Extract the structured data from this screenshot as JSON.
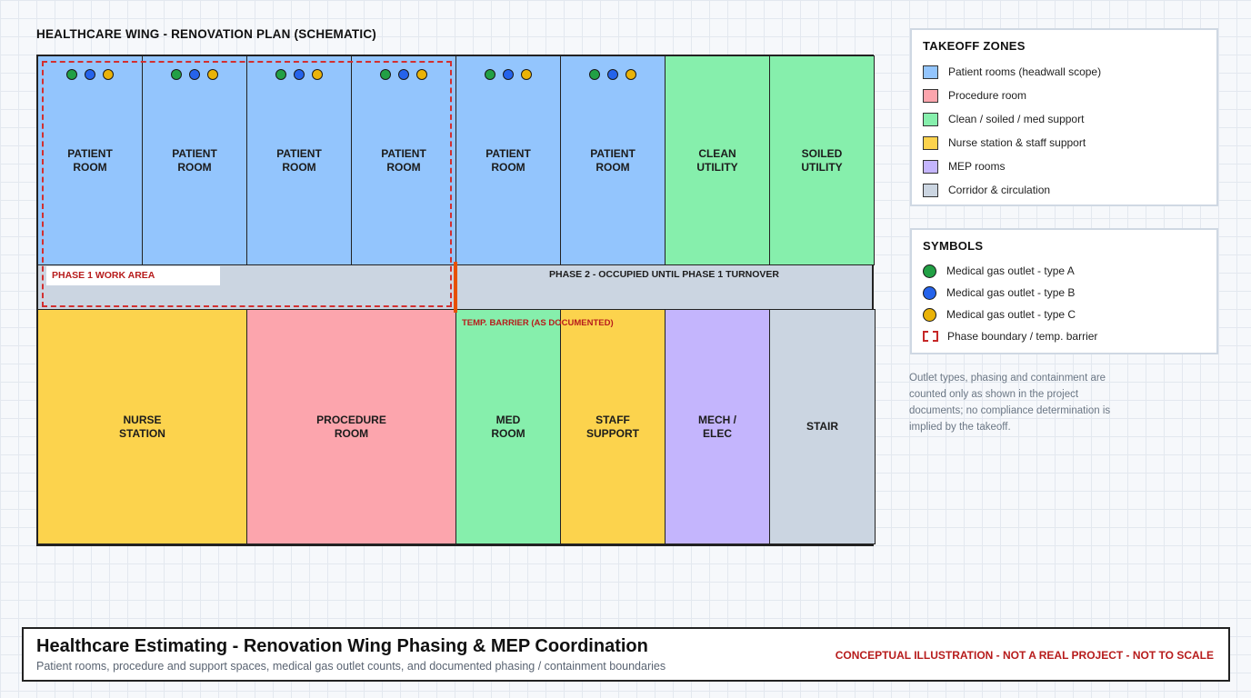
{
  "plan": {
    "title": "HEALTHCARE WING - RENOVATION PLAN (SCHEMATIC)",
    "rooms_top": [
      {
        "label": "PATIENT\nROOM",
        "zone": "patient",
        "outlets": [
          "A",
          "B",
          "C"
        ]
      },
      {
        "label": "PATIENT\nROOM",
        "zone": "patient",
        "outlets": [
          "A",
          "B",
          "C"
        ]
      },
      {
        "label": "PATIENT\nROOM",
        "zone": "patient",
        "outlets": [
          "A",
          "B",
          "C"
        ]
      },
      {
        "label": "PATIENT\nROOM",
        "zone": "patient",
        "outlets": [
          "A",
          "B",
          "C"
        ]
      },
      {
        "label": "PATIENT\nROOM",
        "zone": "patient",
        "outlets": [
          "A",
          "B",
          "C"
        ]
      },
      {
        "label": "PATIENT\nROOM",
        "zone": "patient",
        "outlets": [
          "A",
          "B",
          "C"
        ]
      },
      {
        "label": "CLEAN\nUTILITY",
        "zone": "support"
      },
      {
        "label": "SOILED\nUTILITY",
        "zone": "support"
      }
    ],
    "rooms_bottom": [
      {
        "label": "NURSE\nSTATION",
        "zone": "nurse"
      },
      {
        "label": "PROCEDURE\nROOM",
        "zone": "procedure"
      },
      {
        "label": "MED\nROOM",
        "zone": "support"
      },
      {
        "label": "STAFF\nSUPPORT",
        "zone": "nurse"
      },
      {
        "label": "MECH /\nELEC",
        "zone": "mep"
      },
      {
        "label": "STAIR",
        "zone": "corridor"
      }
    ],
    "phase1_label": "PHASE 1 WORK AREA",
    "phase2_label": "PHASE 2 - OCCUPIED UNTIL PHASE 1 TURNOVER",
    "barrier_label": "TEMP. BARRIER (AS DOCUMENTED)"
  },
  "colors": {
    "patient": "#93c5fd",
    "procedure": "#fca5ad",
    "support": "#86efac",
    "nurse": "#fcd34d",
    "mep": "#c4b5fd",
    "corridor": "#cbd5e1"
  },
  "legend_zones": {
    "title": "TAKEOFF ZONES",
    "items": [
      {
        "label": "Patient rooms (headwall scope)",
        "zone": "patient"
      },
      {
        "label": "Procedure room",
        "zone": "procedure"
      },
      {
        "label": "Clean / soiled / med support",
        "zone": "support"
      },
      {
        "label": "Nurse station & staff support",
        "zone": "nurse"
      },
      {
        "label": "MEP rooms",
        "zone": "mep"
      },
      {
        "label": "Corridor & circulation",
        "zone": "corridor"
      }
    ]
  },
  "legend_symbols": {
    "title": "SYMBOLS",
    "items": [
      {
        "label": "Medical gas outlet - type A",
        "icon": "outlet-a-icon"
      },
      {
        "label": "Medical gas outlet - type B",
        "icon": "outlet-b-icon"
      },
      {
        "label": "Medical gas outlet - type C",
        "icon": "outlet-c-icon"
      },
      {
        "label": "Phase boundary / temp. barrier",
        "icon": "phase-boundary-icon"
      }
    ]
  },
  "note": "Outlet types, phasing and containment are counted only as shown in the project documents; no compliance determination is implied by the takeoff.",
  "footer": {
    "title": "Healthcare Estimating - Renovation Wing Phasing & MEP Coordination",
    "subtitle": "Patient rooms, procedure and support spaces, medical gas outlet counts, and documented phasing / containment boundaries",
    "disclaimer": "CONCEPTUAL ILLUSTRATION - NOT A REAL PROJECT - NOT TO SCALE"
  }
}
